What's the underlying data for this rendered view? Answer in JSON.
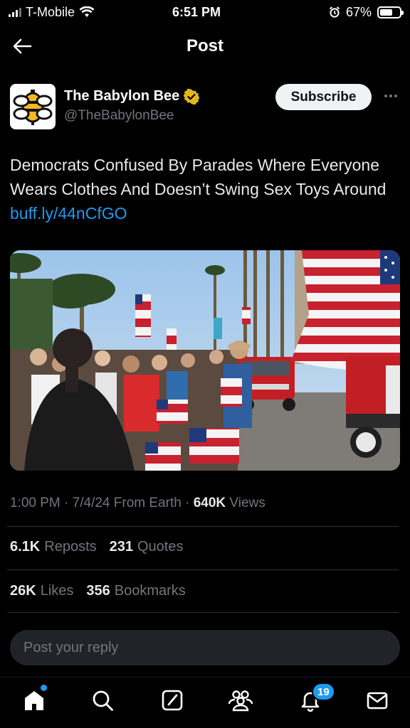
{
  "status_bar": {
    "carrier": "T-Mobile",
    "time": "6:51 PM",
    "battery_percent": "67%",
    "battery_level": 0.67
  },
  "header": {
    "title": "Post"
  },
  "author": {
    "name": "The Babylon Bee",
    "handle": "@TheBabylonBee",
    "verified": true,
    "verified_color": "#e2b719",
    "subscribe_label": "Subscribe"
  },
  "tweet": {
    "text": "Democrats Confused By Parades Where Everyone Wears Clothes And Doesn’t Swing Sex Toys Around ",
    "link": "buff.ly/44nCfGO"
  },
  "meta": {
    "time": "1:00 PM",
    "date": "7/4/24",
    "source": "From Earth",
    "views_count": "640K",
    "views_label": "Views"
  },
  "stats": {
    "reposts_count": "6.1K",
    "reposts_label": "Reposts",
    "quotes_count": "231",
    "quotes_label": "Quotes",
    "likes_count": "26K",
    "likes_label": "Likes",
    "bookmarks_count": "356",
    "bookmarks_label": "Bookmarks"
  },
  "reply": {
    "placeholder": "Post your reply"
  },
  "nav": {
    "items": [
      "home-icon",
      "search-icon",
      "grok-icon",
      "communities-icon",
      "notifications-icon",
      "messages-icon"
    ],
    "notifications_badge": "19",
    "accent_color": "#1d9bf0"
  }
}
